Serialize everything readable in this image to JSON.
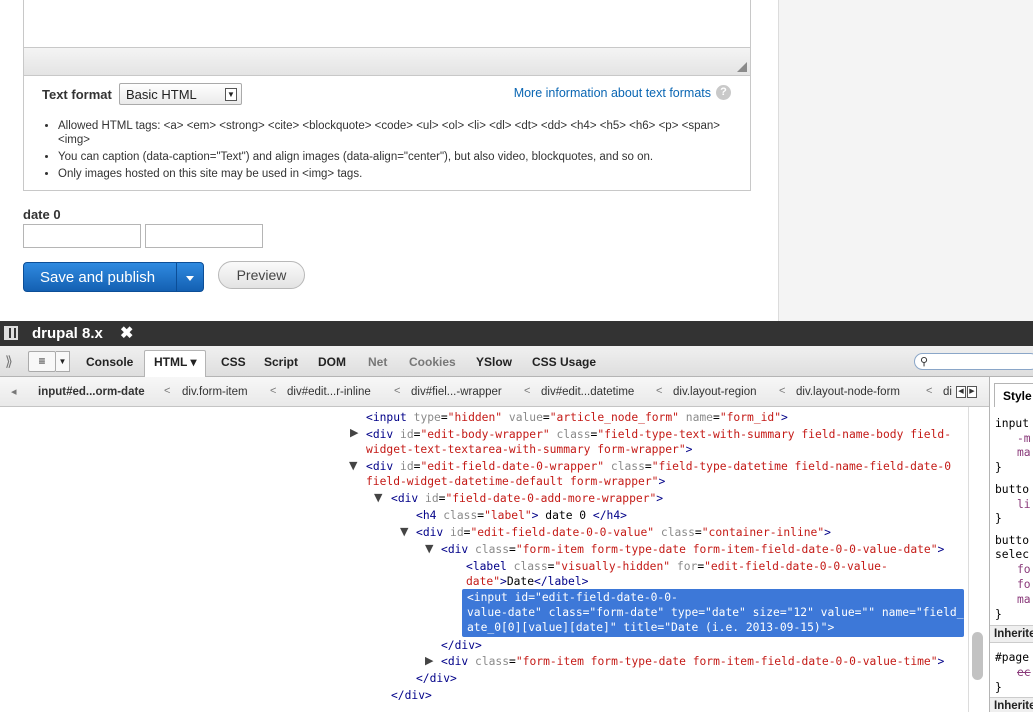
{
  "page": {
    "text_format": {
      "label": "Text format",
      "selected": "Basic HTML",
      "more_info_link": "More information about text formats",
      "help_icon": "?",
      "tips": [
        "Allowed HTML tags: <a> <em> <strong> <cite> <blockquote> <code> <ul> <ol> <li> <dl> <dt> <dd> <h4> <h5> <h6> <p> <span> <img>",
        "You can caption (data-caption=\"Text\") and align images (data-align=\"center\"), but also video, blockquotes, and so on.",
        "Only images hosted on this site may be used in <img> tags."
      ]
    },
    "date_field": {
      "label": "date 0",
      "date_value": "",
      "time_value": ""
    },
    "actions": {
      "save_label": "Save and publish",
      "preview_label": "Preview"
    }
  },
  "firebug": {
    "title": "drupal 8.x",
    "close_glyph": "✖",
    "toolbar": {
      "tabs": [
        "Console",
        "HTML",
        "CSS",
        "Script",
        "DOM",
        "Net",
        "Cookies",
        "YSlow",
        "CSS Usage"
      ],
      "active_tab": "HTML",
      "search_value": ""
    },
    "breadcrumbs": [
      "input#ed...orm-date",
      "div.form-item",
      "div#edit...r-inline",
      "div#fiel...-wrapper",
      "div#edit...datetime",
      "div.layout-region",
      "div.layout-node-form",
      "di"
    ],
    "side_panel": {
      "tab_label": "Style",
      "lines": [
        "input",
        "-m",
        "ma",
        "}",
        "butto",
        "li",
        "}",
        "butto",
        "selec",
        "fo",
        "fo",
        "ma",
        "}"
      ],
      "inherited_heading": "Inherite",
      "lines2": [
        "#page",
        "ec",
        "}"
      ],
      "inherited_heading_2": "Inherite"
    },
    "html_tree": {
      "l1_tag": "input",
      "l1_a1": "type",
      "l1_v1": "\"hidden\"",
      "l1_a2": "value",
      "l1_v2": "\"article_node_form\"",
      "l1_a3": "name",
      "l1_v3": "\"form_id\"",
      "l2_tag": "div",
      "l2_a1": "id",
      "l2_v1": "\"edit-body-wrapper\"",
      "l2_a2": "class",
      "l2_v2a": "\"field-type-text-with-summary field-name-body field-",
      "l2_v2b": "widget-text-textarea-with-summary form-wrapper\"",
      "l3_tag": "div",
      "l3_a1": "id",
      "l3_v1": "\"edit-field-date-0-wrapper\"",
      "l3_a2": "class",
      "l3_v2a": "\"field-type-datetime field-name-field-date-0",
      "l3_v2b": "field-widget-datetime-default form-wrapper\"",
      "l4_tag": "div",
      "l4_a1": "id",
      "l4_v1": "\"field-date-0-add-more-wrapper\"",
      "l5_tag": "h4",
      "l5_a1": "class",
      "l5_v1": "\"label\"",
      "l5_text": "date 0",
      "l6_tag": "div",
      "l6_a1": "id",
      "l6_v1": "\"edit-field-date-0-0-value\"",
      "l6_a2": "class",
      "l6_v2": "\"container-inline\"",
      "l7_tag": "div",
      "l7_a1": "class",
      "l7_v1": "\"form-item form-type-date form-item-field-date-0-0-value-date\"",
      "l8_tag": "label",
      "l8_a1": "class",
      "l8_v1": "\"visually-hidden\"",
      "l8_a2": "for",
      "l8_v2a": "\"edit-field-date-0-0-value-",
      "l8_v2b": "date\"",
      "l8_text": "Date",
      "sel_line1": "<input id=\"edit-field-date-0-0-",
      "sel_line2": "value-date\" class=\"form-date\" type=\"date\" size=\"12\" value=\"\" name=\"field_d",
      "sel_line3": "ate_0[0][value][date]\" title=\"Date (i.e. 2013-09-15)\">",
      "l10_tag": "div",
      "l11_tag": "div",
      "l11_a1": "class",
      "l11_v1": "\"form-item form-type-date form-item-field-date-0-0-value-time\"",
      "l12_tag": "div",
      "l13_tag": "div"
    }
  }
}
